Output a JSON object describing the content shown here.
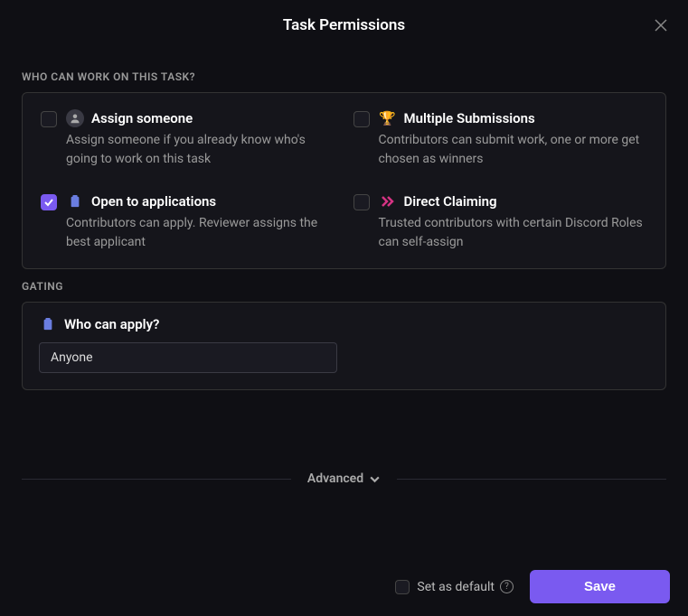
{
  "header": {
    "title": "Task Permissions"
  },
  "sections": {
    "who_label": "WHO CAN WORK ON THIS TASK?",
    "gating_label": "GATING"
  },
  "options": {
    "assign": {
      "title": "Assign someone",
      "desc": "Assign someone if you already know who's going to work on this task",
      "checked": false
    },
    "multiple": {
      "title": "Multiple Submissions",
      "desc": "Contributors can submit work, one or more get chosen as winners",
      "checked": false
    },
    "open": {
      "title": "Open to applications",
      "desc": "Contributors can apply. Reviewer assigns the best applicant",
      "checked": true
    },
    "direct": {
      "title": "Direct Claiming",
      "desc": "Trusted contributors with certain Discord Roles can self-assign",
      "checked": false
    }
  },
  "gating": {
    "title": "Who can apply?",
    "value": "Anyone"
  },
  "advanced": {
    "label": "Advanced"
  },
  "footer": {
    "default_label": "Set as default",
    "default_checked": false,
    "save_label": "Save"
  }
}
